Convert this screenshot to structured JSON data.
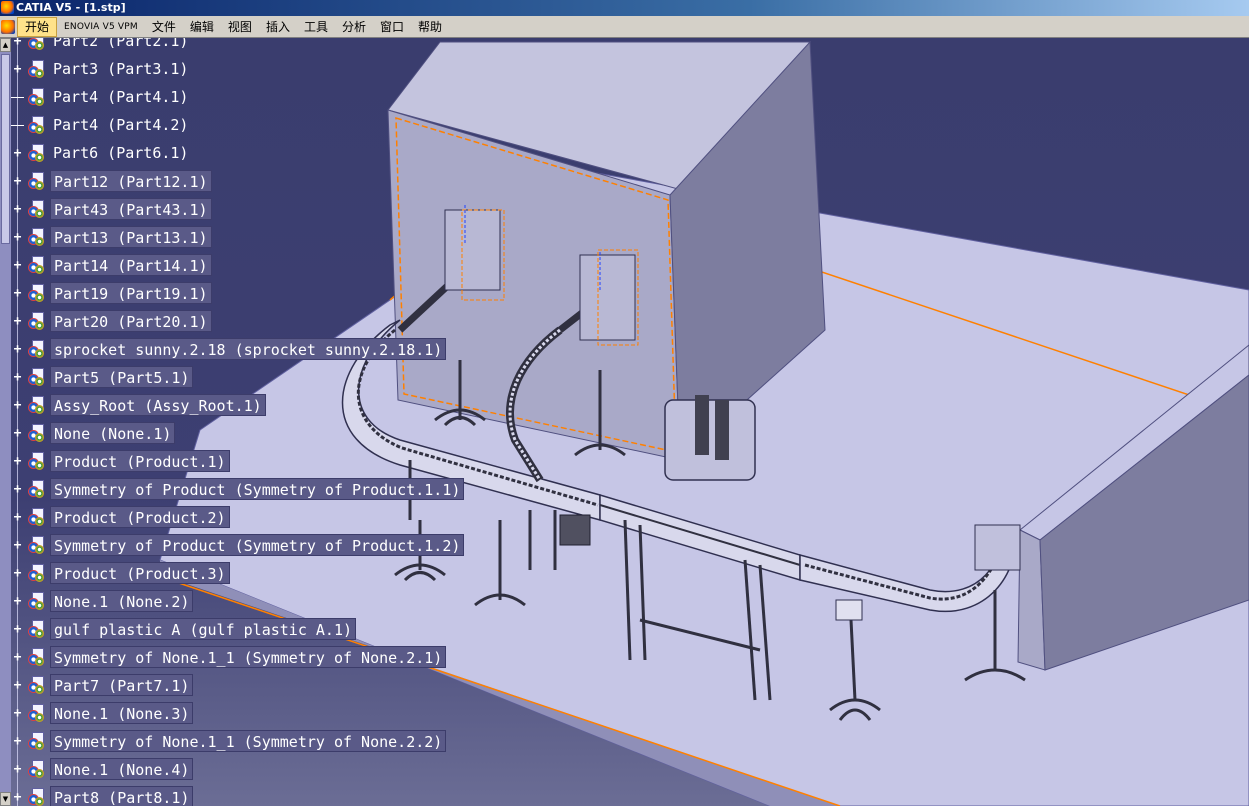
{
  "window": {
    "title": "CATIA V5 - [1.stp]"
  },
  "menu": [
    {
      "label": "开始",
      "active": true
    },
    {
      "label": "ENOVIA V5 VPM"
    },
    {
      "label": "文件"
    },
    {
      "label": "编辑"
    },
    {
      "label": "视图"
    },
    {
      "label": "插入"
    },
    {
      "label": "工具"
    },
    {
      "label": "分析"
    },
    {
      "label": "窗口"
    },
    {
      "label": "帮助"
    }
  ],
  "tree": {
    "items": [
      {
        "label": "Part2 (Part2.1)",
        "expander": "plus",
        "boxed": false,
        "partial": true
      },
      {
        "label": "Part3 (Part3.1)",
        "expander": "plus",
        "boxed": false
      },
      {
        "label": "Part4 (Part4.1)",
        "expander": "dash",
        "boxed": false
      },
      {
        "label": "Part4 (Part4.2)",
        "expander": "dash",
        "boxed": false
      },
      {
        "label": "Part6 (Part6.1)",
        "expander": "plus",
        "boxed": false
      },
      {
        "label": "Part12 (Part12.1)",
        "expander": "plus",
        "boxed": true
      },
      {
        "label": "Part43 (Part43.1)",
        "expander": "plus",
        "boxed": true
      },
      {
        "label": "Part13 (Part13.1)",
        "expander": "plus",
        "boxed": true
      },
      {
        "label": "Part14 (Part14.1)",
        "expander": "plus",
        "boxed": true
      },
      {
        "label": "Part19 (Part19.1)",
        "expander": "plus",
        "boxed": true
      },
      {
        "label": "Part20 (Part20.1)",
        "expander": "plus",
        "boxed": true
      },
      {
        "label": "sprocket sunny.2.18 (sprocket sunny.2.18.1)",
        "expander": "plus",
        "boxed": true
      },
      {
        "label": "Part5 (Part5.1)",
        "expander": "plus",
        "boxed": true
      },
      {
        "label": "Assy_Root (Assy_Root.1)",
        "expander": "plus",
        "boxed": true
      },
      {
        "label": "None (None.1)",
        "expander": "plus",
        "boxed": true
      },
      {
        "label": "Product (Product.1)",
        "expander": "plus",
        "boxed": true
      },
      {
        "label": "Symmetry of Product (Symmetry of Product.1.1)",
        "expander": "plus",
        "boxed": true
      },
      {
        "label": "Product (Product.2)",
        "expander": "plus",
        "boxed": true
      },
      {
        "label": "Symmetry of Product (Symmetry of Product.1.2)",
        "expander": "plus",
        "boxed": true
      },
      {
        "label": "Product (Product.3)",
        "expander": "plus",
        "boxed": true
      },
      {
        "label": "None.1 (None.2)",
        "expander": "plus",
        "boxed": true
      },
      {
        "label": "gulf plastic A (gulf plastic A.1)",
        "expander": "plus",
        "boxed": true
      },
      {
        "label": "Symmetry of None.1_1 (Symmetry of None.2.1)",
        "expander": "plus",
        "boxed": true
      },
      {
        "label": "Part7 (Part7.1)",
        "expander": "plus",
        "boxed": true
      },
      {
        "label": "None.1 (None.3)",
        "expander": "plus",
        "boxed": true
      },
      {
        "label": "Symmetry of None.1_1 (Symmetry of None.2.2)",
        "expander": "plus",
        "boxed": true
      },
      {
        "label": "None.1 (None.4)",
        "expander": "plus",
        "boxed": true
      },
      {
        "label": "Part8 (Part8.1)",
        "expander": "plus",
        "boxed": true
      }
    ]
  },
  "colors": {
    "background": "#3a3d6e",
    "floor": "#c6c6e6",
    "box_front": "#a8a8c8",
    "box_side": "#7a7a9c",
    "highlight_orange": "#ff8000"
  },
  "icons": {
    "app": "catia-logo-icon",
    "node": "assembly-component-icon"
  }
}
